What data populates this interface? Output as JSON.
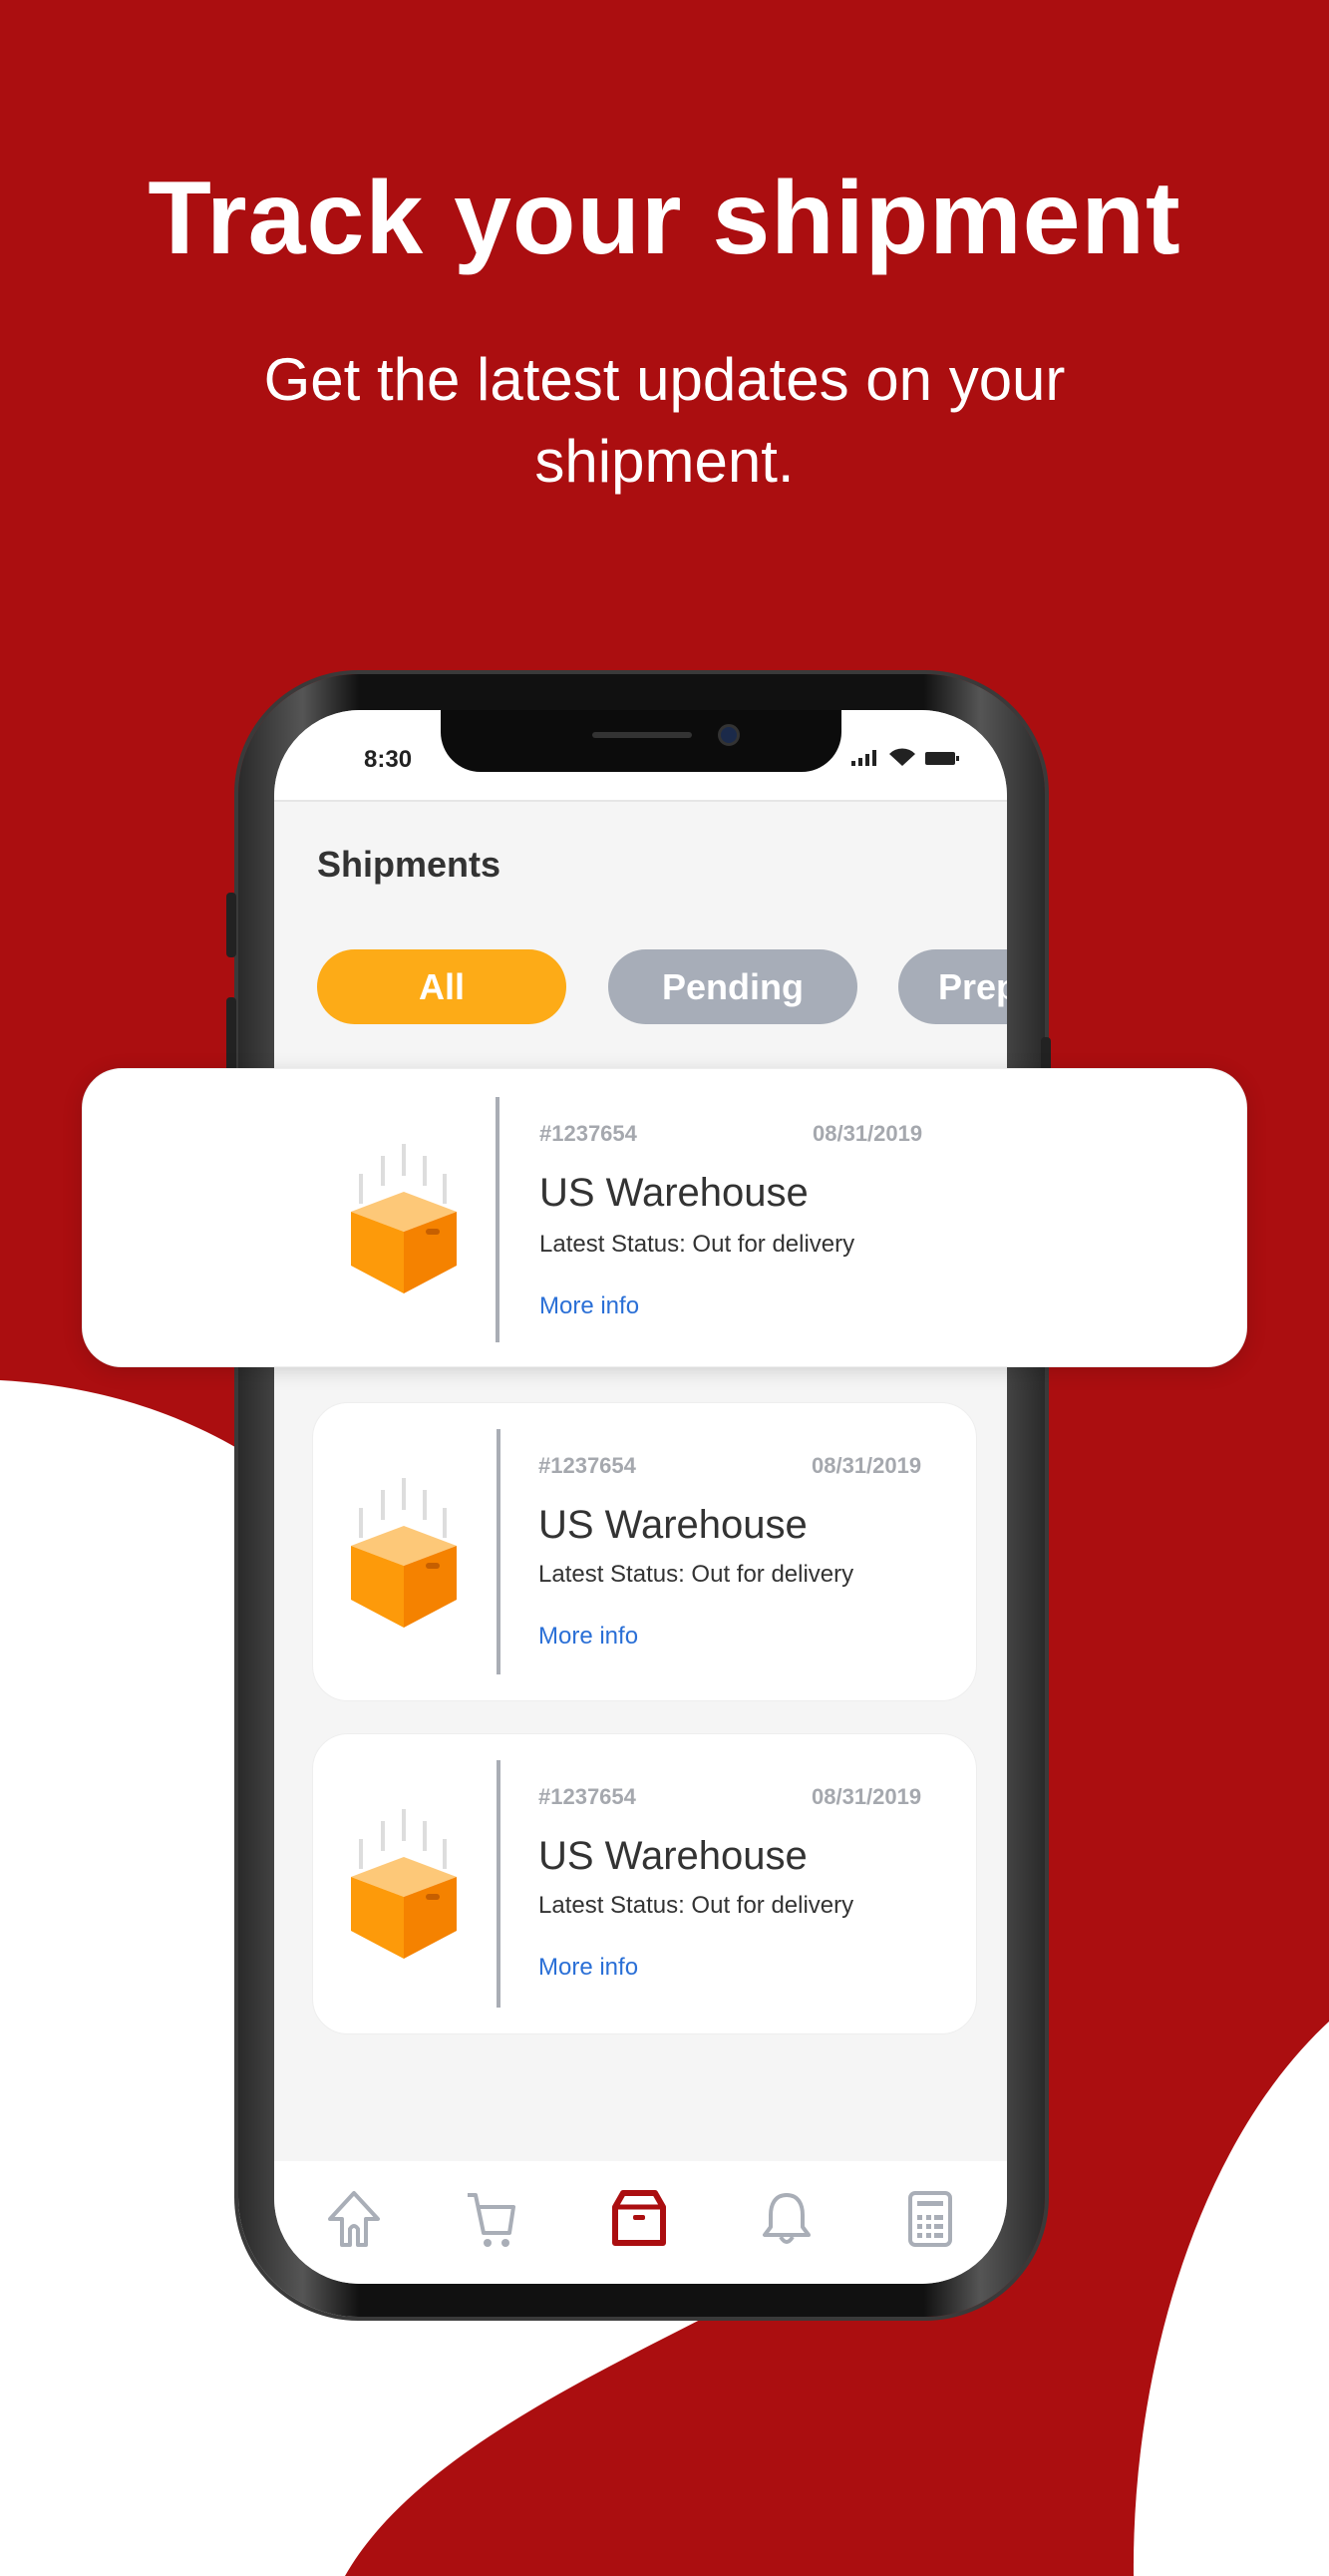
{
  "hero": {
    "title": "Track your shipment",
    "subtitle": "Get the latest updates on your shipment."
  },
  "colors": {
    "background": "#ab0e10",
    "accent": "#fdab17",
    "pill_inactive": "#a7adb8",
    "link": "#2a6fd6",
    "active_tab": "#ab0e10"
  },
  "status_bar": {
    "time": "8:30"
  },
  "screen": {
    "title": "Shipments"
  },
  "filters": [
    {
      "label": "All",
      "active": true
    },
    {
      "label": "Pending",
      "active": false
    },
    {
      "label": "Prep",
      "active": false
    }
  ],
  "shipments": [
    {
      "number": "#1237654",
      "date": "08/31/2019",
      "name": "US Warehouse",
      "status": "Latest Status: Out for delivery",
      "link": "More info"
    },
    {
      "number": "#1237654",
      "date": "08/31/2019",
      "name": "US Warehouse",
      "status": "Latest Status: Out for delivery",
      "link": "More info"
    },
    {
      "number": "#1237654",
      "date": "08/31/2019",
      "name": "US Warehouse",
      "status": "Latest Status: Out for delivery",
      "link": "More info"
    }
  ],
  "tabs": [
    {
      "icon": "home-icon"
    },
    {
      "icon": "cart-icon"
    },
    {
      "icon": "box-icon",
      "active": true
    },
    {
      "icon": "bell-icon"
    },
    {
      "icon": "calculator-icon"
    }
  ]
}
